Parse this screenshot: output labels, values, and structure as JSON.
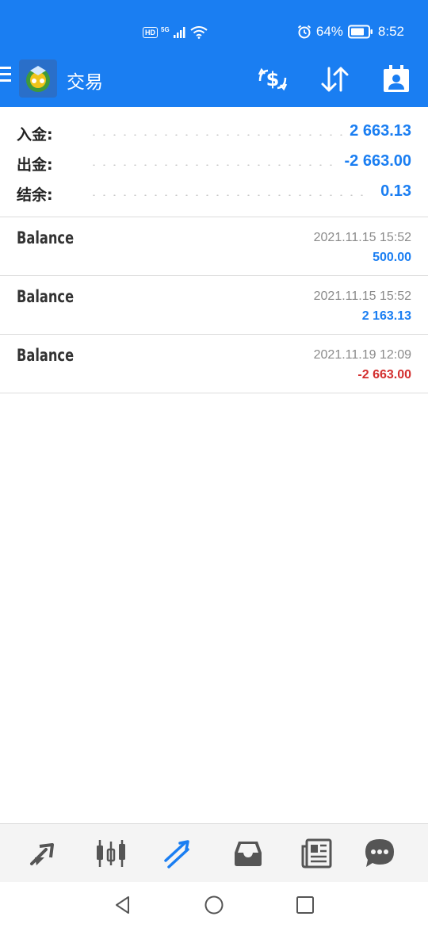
{
  "status_bar": {
    "hd": "HD",
    "network": "5G",
    "battery_percent": "64%",
    "time": "8:52"
  },
  "app_bar": {
    "title": "交易",
    "icons": [
      "menu-icon",
      "app-logo",
      "exchange-dollar-icon",
      "sort-arrows-icon",
      "account-icon"
    ]
  },
  "summary": [
    {
      "label": "入金:",
      "value": "2 663.13"
    },
    {
      "label": "出金:",
      "value": "-2 663.00"
    },
    {
      "label": "结余:",
      "value": "0.13"
    }
  ],
  "deals": [
    {
      "type": "Balance",
      "time": "2021.11.15 15:52",
      "amount": "500.00",
      "sign": "positive"
    },
    {
      "type": "Balance",
      "time": "2021.11.15 15:52",
      "amount": "2 163.13",
      "sign": "positive"
    },
    {
      "type": "Balance",
      "time": "2021.11.19 12:09",
      "amount": "-2 663.00",
      "sign": "negative"
    }
  ],
  "bottom_nav": {
    "items": [
      "quotes-icon",
      "chart-icon",
      "trade-icon",
      "history-icon",
      "news-icon",
      "chat-icon"
    ],
    "active": "trade-icon"
  },
  "colors": {
    "accent": "#1a7ef2",
    "positive": "#1a7ef2",
    "negative": "#d32f2f",
    "icon_gray": "#555555"
  }
}
